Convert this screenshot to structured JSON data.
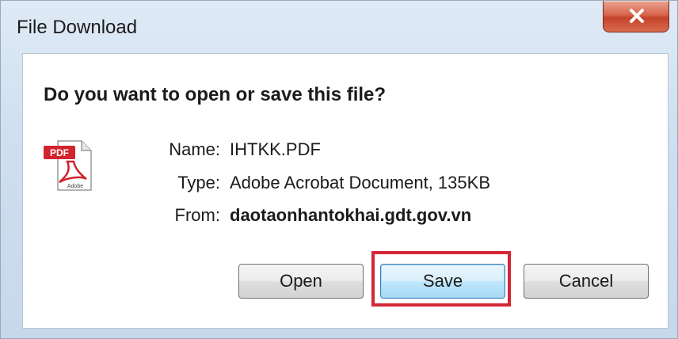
{
  "window": {
    "title": "File Download",
    "close_glyph": "X"
  },
  "dialog": {
    "question": "Do you want to open or save this file?",
    "file_icon": "pdf-file-icon",
    "file_icon_text": "PDF",
    "file_icon_logo": "Adobe",
    "name_label": "Name:",
    "name_value": "IHTKK.PDF",
    "type_label": "Type:",
    "type_value": "Adobe Acrobat Document, 135KB",
    "from_label": "From:",
    "from_value": "daotaonhantokhai.gdt.gov.vn"
  },
  "buttons": {
    "open_label": "Open",
    "save_label": "Save",
    "cancel_label": "Cancel"
  },
  "colors": {
    "highlight": "#d42636",
    "close_button": "#c4442a",
    "pdf_red": "#d3232f"
  }
}
